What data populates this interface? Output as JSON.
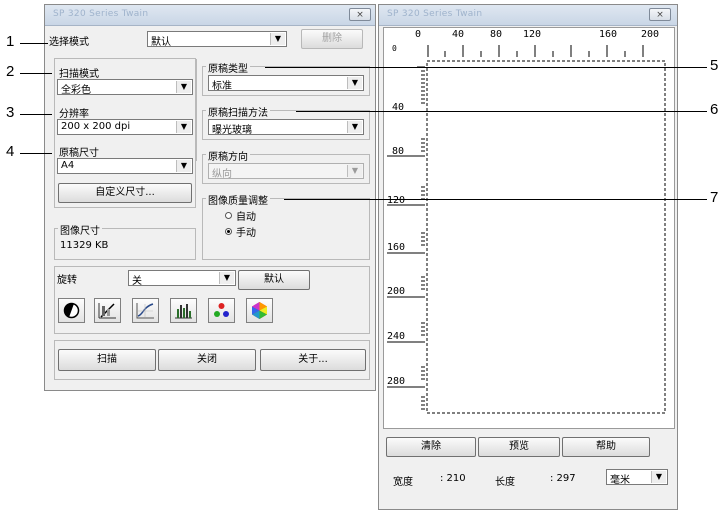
{
  "left_window": {
    "title": "SP 320 Series Twain",
    "close_icon": "×",
    "select_mode": {
      "label": "选择模式",
      "value": "默认",
      "delete_button": "删除"
    },
    "scan_mode": {
      "label": "扫描模式",
      "value": "全彩色"
    },
    "resolution": {
      "label": "分辨率",
      "value": "200 x 200 dpi"
    },
    "original_size": {
      "label": "原稿尺寸",
      "value": "A4"
    },
    "custom_size_button": "自定义尺寸...",
    "image_size": {
      "label": "图像尺寸",
      "value": "11329 KB"
    },
    "original_type": {
      "label": "原稿类型",
      "value": "标准"
    },
    "scan_method": {
      "label": "原稿扫描方法",
      "value": "曝光玻璃"
    },
    "orientation": {
      "label": "原稿方向",
      "value": "纵向"
    },
    "image_quality": {
      "label": "图像质量调整",
      "auto": "自动",
      "manual": "手动",
      "selected": "manual"
    },
    "rotation": {
      "label": "旋转",
      "value": "关",
      "default_button": "默认"
    },
    "tool_icons": [
      "brightness-contrast-icon",
      "threshold-icon",
      "curve-icon",
      "histogram-icon",
      "color-balance-icon",
      "hue-saturation-icon"
    ],
    "bottom_buttons": {
      "scan": "扫描",
      "close": "关闭",
      "about": "关于..."
    }
  },
  "right_window": {
    "title": "SP 320 Series Twain",
    "close_icon": "×",
    "ruler_top": [
      "0",
      "40",
      "80",
      "120",
      "160",
      "200"
    ],
    "ruler_left": [
      "0",
      "40",
      "80",
      "120",
      "160",
      "200",
      "240",
      "280"
    ],
    "buttons": {
      "clear": "清除",
      "preview": "预览",
      "help": "帮助"
    },
    "width_label": "宽度",
    "width_value": ": 210",
    "length_label": "长度",
    "length_value": ": 297",
    "unit": "毫米"
  },
  "callouts": [
    "1",
    "2",
    "3",
    "4",
    "5",
    "6",
    "7"
  ]
}
